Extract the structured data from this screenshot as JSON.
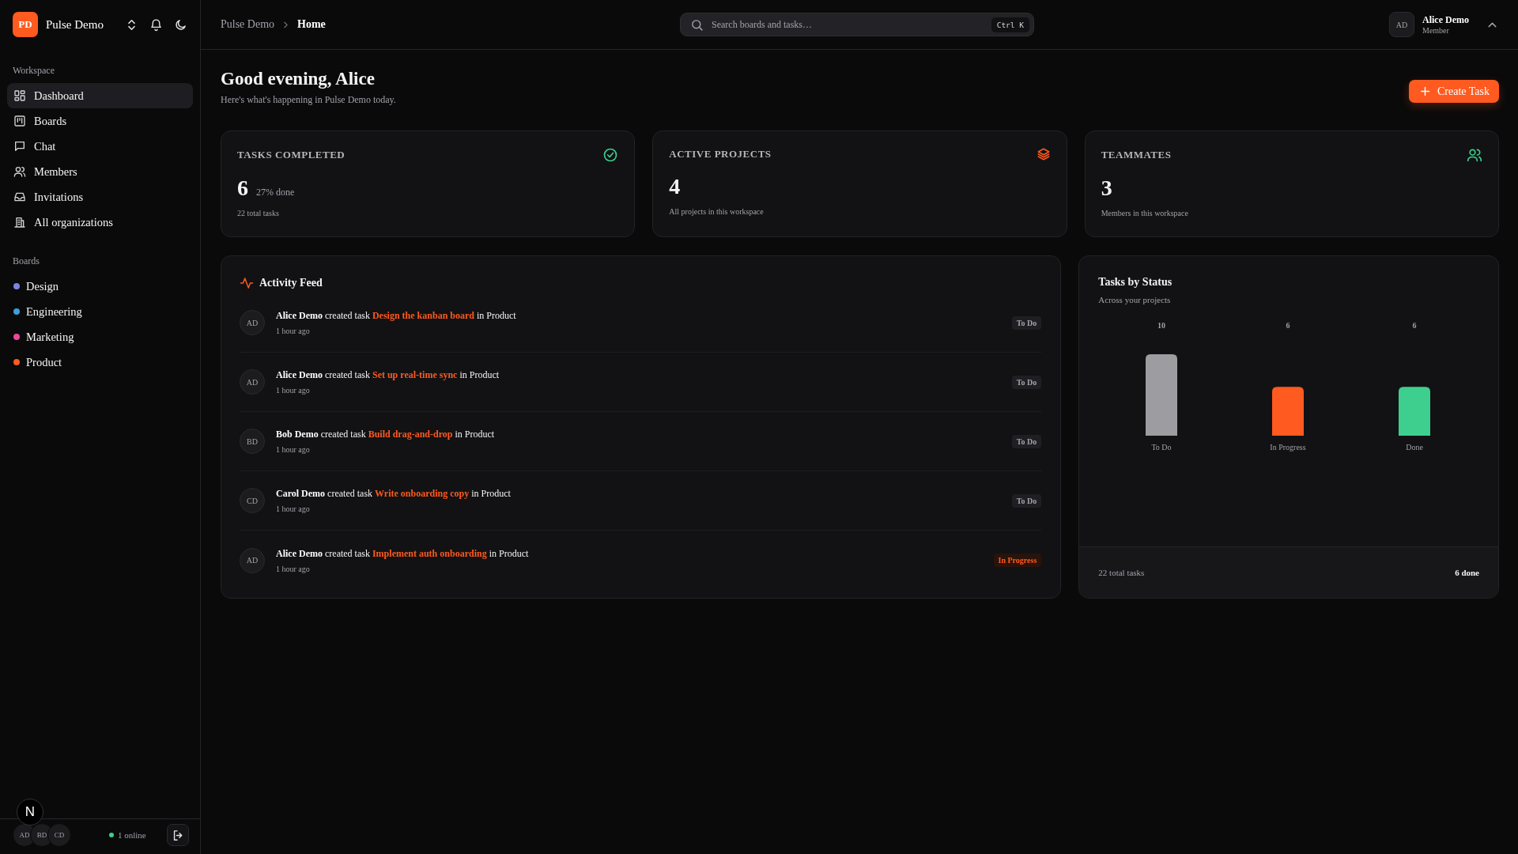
{
  "org": {
    "initials": "PD",
    "name": "Pulse Demo"
  },
  "sidebar": {
    "sections": [
      {
        "title": "Workspace",
        "items": [
          {
            "label": "Dashboard",
            "selected": true
          },
          {
            "label": "Boards",
            "selected": false
          },
          {
            "label": "Chat",
            "selected": false
          },
          {
            "label": "Members",
            "selected": false
          },
          {
            "label": "Invitations",
            "selected": false
          },
          {
            "label": "All organizations",
            "selected": false
          }
        ]
      }
    ],
    "boards_title": "Boards",
    "boards": [
      {
        "label": "Design",
        "color": "#7c83e0"
      },
      {
        "label": "Engineering",
        "color": "#3b9ee0"
      },
      {
        "label": "Marketing",
        "color": "#ec4899"
      },
      {
        "label": "Product",
        "color": "#ff5a1f"
      }
    ],
    "footer": {
      "avatars": [
        "AD",
        "BD",
        "CD"
      ],
      "badge": "N",
      "online": "1 online"
    }
  },
  "breadcrumb": [
    "Pulse Demo",
    "Home"
  ],
  "search": {
    "placeholder": "Search boards and tasks…",
    "shortcut": "Ctrl K"
  },
  "user": {
    "initials": "AD",
    "name": "Alice Demo",
    "role": "Member"
  },
  "greeting": {
    "title": "Good evening, Alice",
    "subtitle": "Here's what's happening in Pulse Demo today."
  },
  "create_button": "Create Task",
  "stats": [
    {
      "title": "TASKS COMPLETED",
      "value": "6",
      "extra": "27% done",
      "note": "22 total tasks"
    },
    {
      "title": "ACTIVE PROJECTS",
      "value": "4",
      "note": "All projects in this workspace"
    },
    {
      "title": "TEAMMATES",
      "value": "3",
      "note": "Members in this workspace"
    }
  ],
  "activity": {
    "title": "Activity Feed",
    "items": [
      {
        "initials": "AD",
        "actor": "Alice Demo",
        "action": "created task",
        "task": "Design the kanban board",
        "prep": "in",
        "board": "Product",
        "time": "1 hour ago",
        "status": "To Do",
        "kind": "todo"
      },
      {
        "initials": "AD",
        "actor": "Alice Demo",
        "action": "created task",
        "task": "Set up real-time sync",
        "prep": "in",
        "board": "Product",
        "time": "1 hour ago",
        "status": "To Do",
        "kind": "todo"
      },
      {
        "initials": "BD",
        "actor": "Bob Demo",
        "action": "created task",
        "task": "Build drag-and-drop",
        "prep": "in",
        "board": "Product",
        "time": "1 hour ago",
        "status": "To Do",
        "kind": "todo"
      },
      {
        "initials": "CD",
        "actor": "Carol Demo",
        "action": "created task",
        "task": "Write onboarding copy",
        "prep": "in",
        "board": "Product",
        "time": "1 hour ago",
        "status": "To Do",
        "kind": "todo"
      },
      {
        "initials": "AD",
        "actor": "Alice Demo",
        "action": "created task",
        "task": "Implement auth onboarding",
        "prep": "in",
        "board": "Product",
        "time": "1 hour ago",
        "status": "In Progress",
        "kind": "progress"
      }
    ]
  },
  "status_chart": {
    "title": "Tasks by Status",
    "subtitle": "Across your projects",
    "chart_data": {
      "type": "bar",
      "categories": [
        "To Do",
        "In Progress",
        "Done"
      ],
      "data_labels": true,
      "values": [
        10,
        6,
        6
      ],
      "colors": [
        "#9d9ca1",
        "#ff5a1f",
        "#3ecf8e"
      ]
    },
    "total": "22 total tasks",
    "done": "6 done"
  }
}
